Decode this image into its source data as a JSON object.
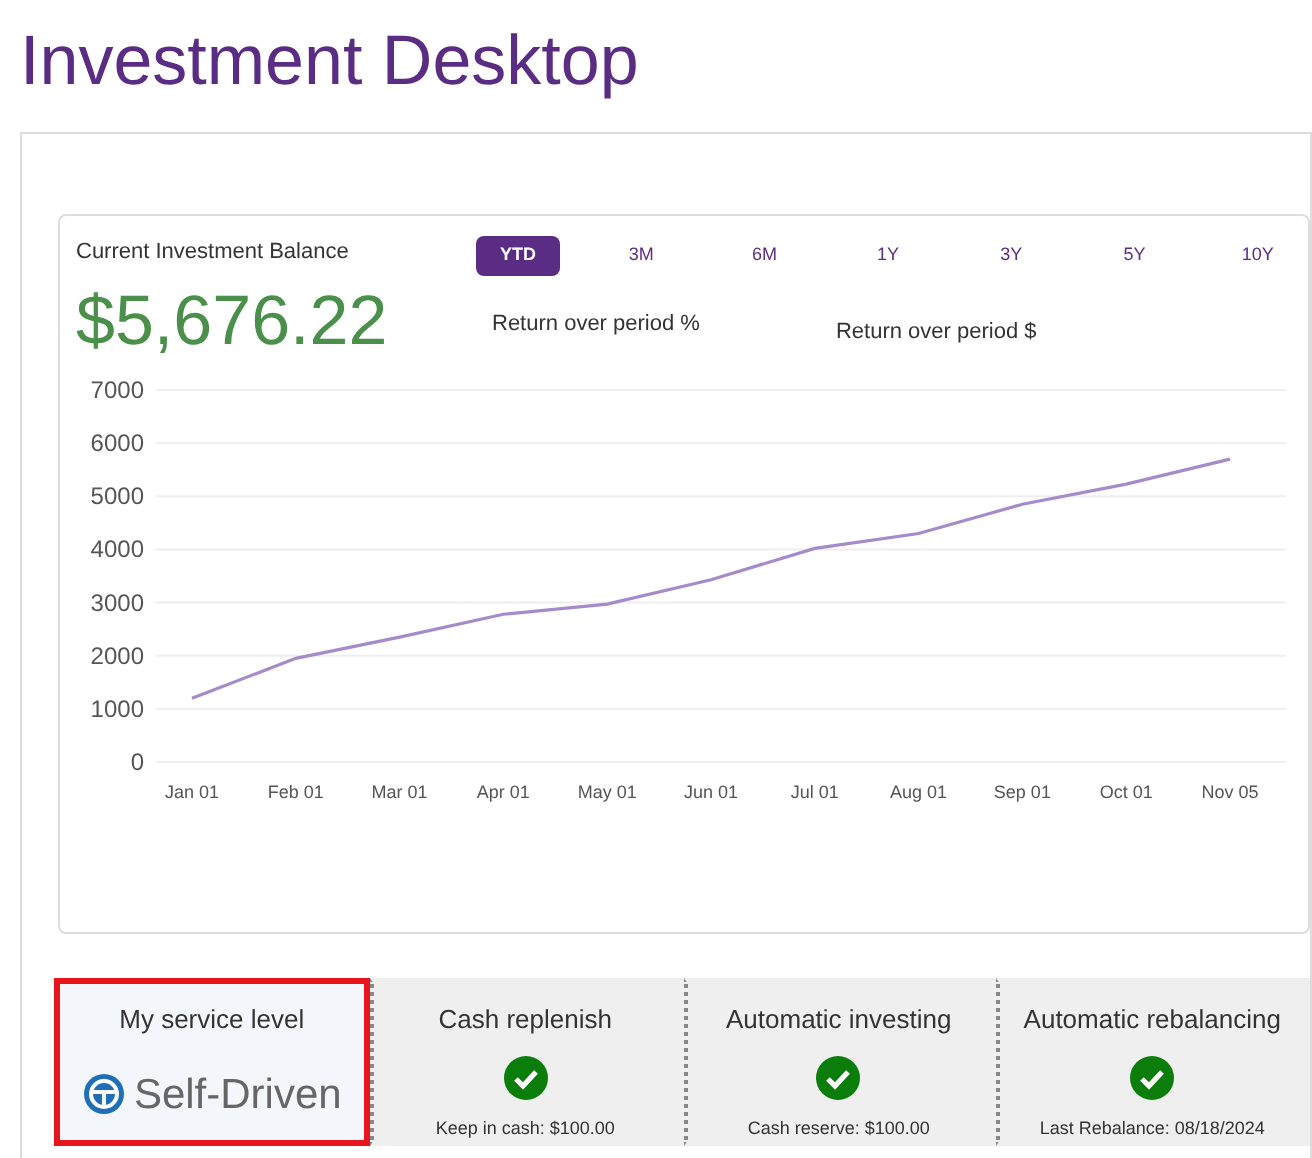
{
  "page_title": "Investment Desktop",
  "balance": {
    "label": "Current Investment Balance",
    "value": "$5,676.22"
  },
  "periods": [
    {
      "label": "YTD",
      "selected": true
    },
    {
      "label": "3M",
      "selected": false
    },
    {
      "label": "6M",
      "selected": false
    },
    {
      "label": "1Y",
      "selected": false
    },
    {
      "label": "3Y",
      "selected": false
    },
    {
      "label": "5Y",
      "selected": false
    },
    {
      "label": "10Y",
      "selected": false
    }
  ],
  "returns": [
    {
      "label": "Return over period %"
    },
    {
      "label": "Return over period $"
    }
  ],
  "chart_data": {
    "type": "line",
    "categories": [
      "Jan 01",
      "Feb 01",
      "Mar 01",
      "Apr 01",
      "May 01",
      "Jun 01",
      "Jul 01",
      "Aug 01",
      "Sep 01",
      "Oct 01",
      "Nov 05"
    ],
    "series": [
      {
        "color": "#a58bc9",
        "values": [
          1200,
          1950,
          2350,
          2780,
          2970,
          3430,
          4020,
          4300,
          4850,
          5230,
          5700
        ]
      }
    ],
    "grid": true,
    "ylim": [
      0,
      7000
    ],
    "yticks": [
      0,
      1000,
      2000,
      3000,
      4000,
      5000,
      6000,
      7000
    ]
  },
  "tiles": [
    {
      "kind": "service",
      "title": "My service level",
      "value": "Self-Driven",
      "highlighted": true
    },
    {
      "kind": "status",
      "title": "Cash replenish",
      "enabled": true,
      "note": "Keep in cash: $100.00",
      "highlighted": false
    },
    {
      "kind": "status",
      "title": "Automatic investing",
      "enabled": true,
      "note": "Cash reserve: $100.00",
      "highlighted": false
    },
    {
      "kind": "status",
      "title": "Automatic rebalancing",
      "enabled": true,
      "note": "Last Rebalance: 08/18/2024",
      "highlighted": false
    }
  ]
}
